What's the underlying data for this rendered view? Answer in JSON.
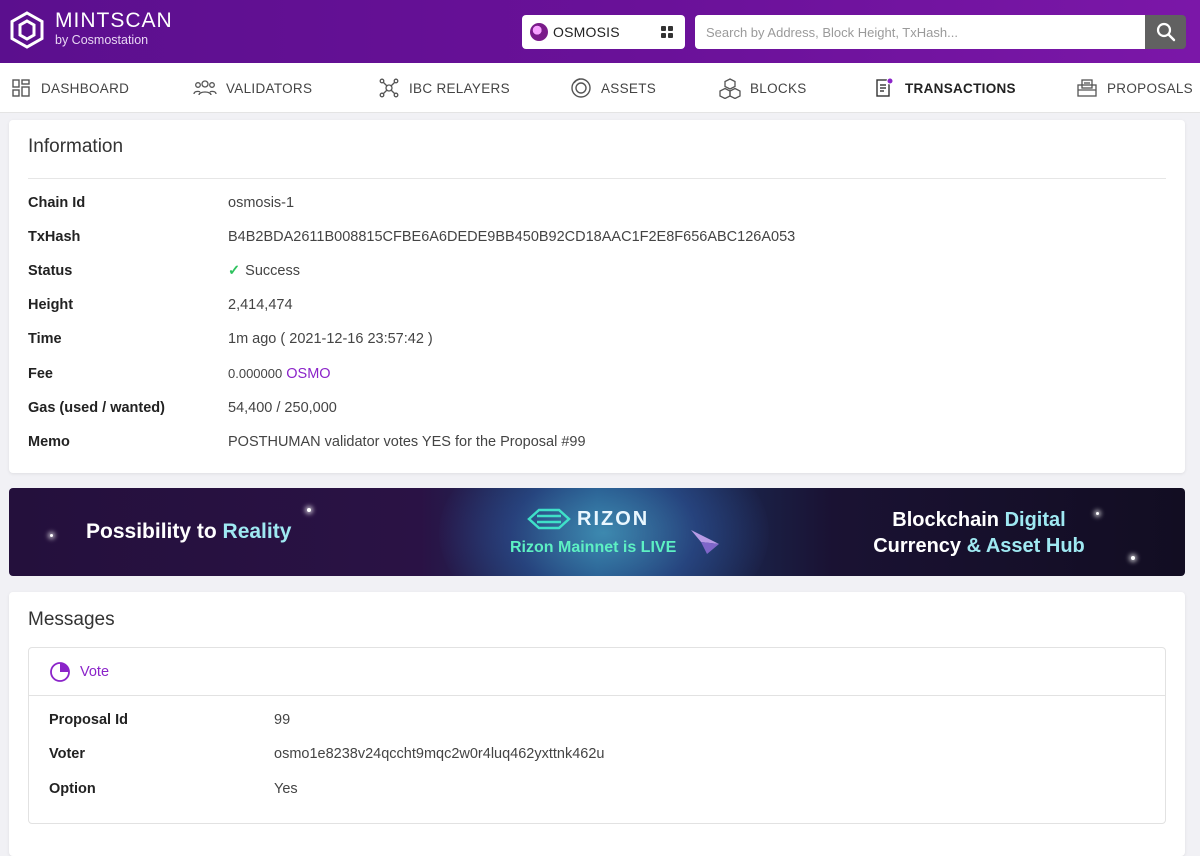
{
  "header": {
    "brand_name": "MINTSCAN",
    "brand_sub": "by Cosmostation",
    "chain_name": "OSMOSIS",
    "search_placeholder": "Search by Address, Block Height, TxHash..."
  },
  "nav": [
    {
      "label": "DASHBOARD",
      "icon": "dashboard-icon"
    },
    {
      "label": "VALIDATORS",
      "icon": "validators-icon"
    },
    {
      "label": "IBC RELAYERS",
      "icon": "ibc-relayers-icon"
    },
    {
      "label": "ASSETS",
      "icon": "assets-icon"
    },
    {
      "label": "BLOCKS",
      "icon": "blocks-icon"
    },
    {
      "label": "TRANSACTIONS",
      "icon": "transactions-icon",
      "active": true
    },
    {
      "label": "PROPOSALS",
      "icon": "proposals-icon"
    }
  ],
  "information": {
    "title": "Information",
    "chain_id_label": "Chain Id",
    "chain_id": "osmosis-1",
    "txhash_label": "TxHash",
    "txhash": "B4B2BDA2611B008815CFBE6A6DEDE9BB450B92CD18AAC1F2E8F656ABC126A053",
    "status_label": "Status",
    "status": "Success",
    "height_label": "Height",
    "height": "2,414,474",
    "time_label": "Time",
    "time": "1m ago ( 2021-12-16 23:57:42 )",
    "fee_label": "Fee",
    "fee_amount": "0.000000",
    "fee_denom": "OSMO",
    "gas_label": "Gas (used / wanted)",
    "gas": "54,400 / 250,000",
    "memo_label": "Memo",
    "memo": "POSTHUMAN validator votes YES for the Proposal #99"
  },
  "banner": {
    "left_text_1": "Possibility to ",
    "left_text_2": "Reality",
    "logo_name": "RIZON",
    "subtitle": "Rizon Mainnet is LIVE",
    "right_line_1a": "Blockchain ",
    "right_line_1b": "Digital",
    "right_line_2a": "Currency ",
    "right_line_2b": "& Asset Hub"
  },
  "messages": {
    "title": "Messages",
    "type": "Vote",
    "proposal_id_label": "Proposal Id",
    "proposal_id": "99",
    "voter_label": "Voter",
    "voter": "osmo1e8238v24qccht9mqc2w0r4luq462yxttnk462u",
    "option_label": "Option",
    "option": "Yes"
  }
}
